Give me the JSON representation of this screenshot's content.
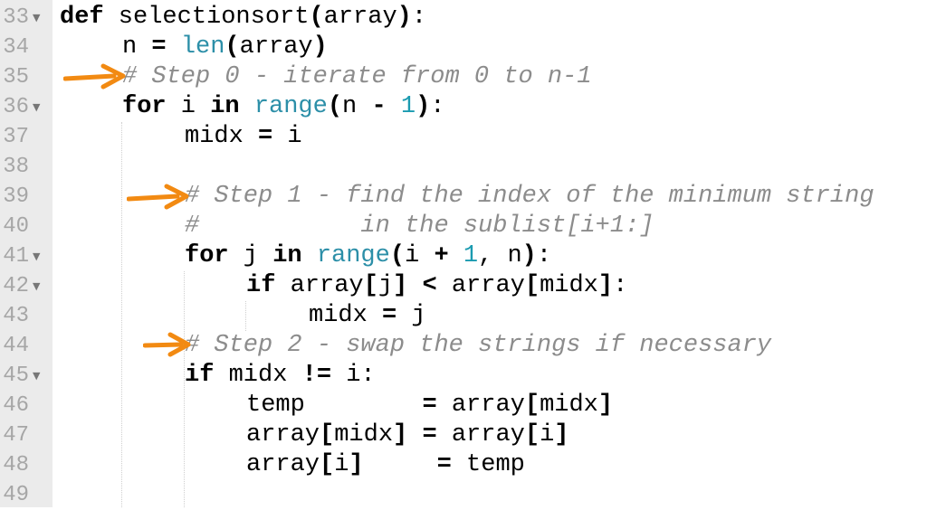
{
  "editor": {
    "accent_color": "#f28a12",
    "gutter_color": "#ebebeb",
    "lines": [
      {
        "n": "33",
        "fold": true
      },
      {
        "n": "34",
        "fold": false
      },
      {
        "n": "35",
        "fold": false
      },
      {
        "n": "36",
        "fold": true
      },
      {
        "n": "37",
        "fold": false
      },
      {
        "n": "38",
        "fold": false
      },
      {
        "n": "39",
        "fold": false
      },
      {
        "n": "40",
        "fold": false
      },
      {
        "n": "41",
        "fold": true
      },
      {
        "n": "42",
        "fold": true
      },
      {
        "n": "43",
        "fold": false
      },
      {
        "n": "44",
        "fold": false
      },
      {
        "n": "45",
        "fold": true
      },
      {
        "n": "46",
        "fold": false
      },
      {
        "n": "47",
        "fold": false
      },
      {
        "n": "48",
        "fold": false
      },
      {
        "n": "49",
        "fold": false
      }
    ],
    "code": {
      "l33": {
        "kw_def": "def",
        "t1": " selectionsort",
        "b1": "(",
        "t2": "array",
        "b2": ")",
        "t3": ":"
      },
      "l34": {
        "t1": "n ",
        "op": "=",
        "t2": " ",
        "fn": "len",
        "b1": "(",
        "t3": "array",
        "b2": ")"
      },
      "l35": {
        "comment": "# Step 0 - iterate from 0 to n-1"
      },
      "l36": {
        "kw_for": "for",
        "t1": " i ",
        "kw_in": "in",
        "t2": " ",
        "fn": "range",
        "b1": "(",
        "t3": "n ",
        "op": "-",
        "t4": " ",
        "num": "1",
        "b2": ")",
        "t5": ":"
      },
      "l37": {
        "t1": "midx ",
        "op": "=",
        "t2": " i"
      },
      "l39": {
        "comment": "# Step 1 - find the index of the minimum string"
      },
      "l40": {
        "comment": "#           in the sublist[i+1:]"
      },
      "l41": {
        "kw_for": "for",
        "t1": " j ",
        "kw_in": "in",
        "t2": " ",
        "fn": "range",
        "b1": "(",
        "t3": "i ",
        "op": "+",
        "t4": " ",
        "num": "1",
        "t5": ", n",
        "b2": ")",
        "t6": ":"
      },
      "l42": {
        "kw_if": "if",
        "t1": " array",
        "b1": "[",
        "t2": "j",
        "b2": "]",
        "t3": " ",
        "op": "<",
        "t4": " array",
        "b3": "[",
        "t5": "midx",
        "b4": "]",
        "t6": ":"
      },
      "l43": {
        "t1": "midx ",
        "op": "=",
        "t2": " j"
      },
      "l44": {
        "comment": "# Step 2 - swap the strings if necessary"
      },
      "l45": {
        "kw_if": "if",
        "t1": " midx ",
        "op": "!=",
        "t2": " i:"
      },
      "l46": {
        "t1": "temp        ",
        "op": "=",
        "t2": " array",
        "b1": "[",
        "t3": "midx",
        "b2": "]"
      },
      "l47": {
        "t1": "array",
        "b1": "[",
        "t2": "midx",
        "b2": "]",
        "t3": " ",
        "op": "=",
        "t4": " array",
        "b3": "[",
        "t5": "i",
        "b4": "]"
      },
      "l48": {
        "t1": "array",
        "b1": "[",
        "t2": "i",
        "b2": "]",
        "t3": "     ",
        "op": "=",
        "t4": " temp"
      }
    }
  }
}
